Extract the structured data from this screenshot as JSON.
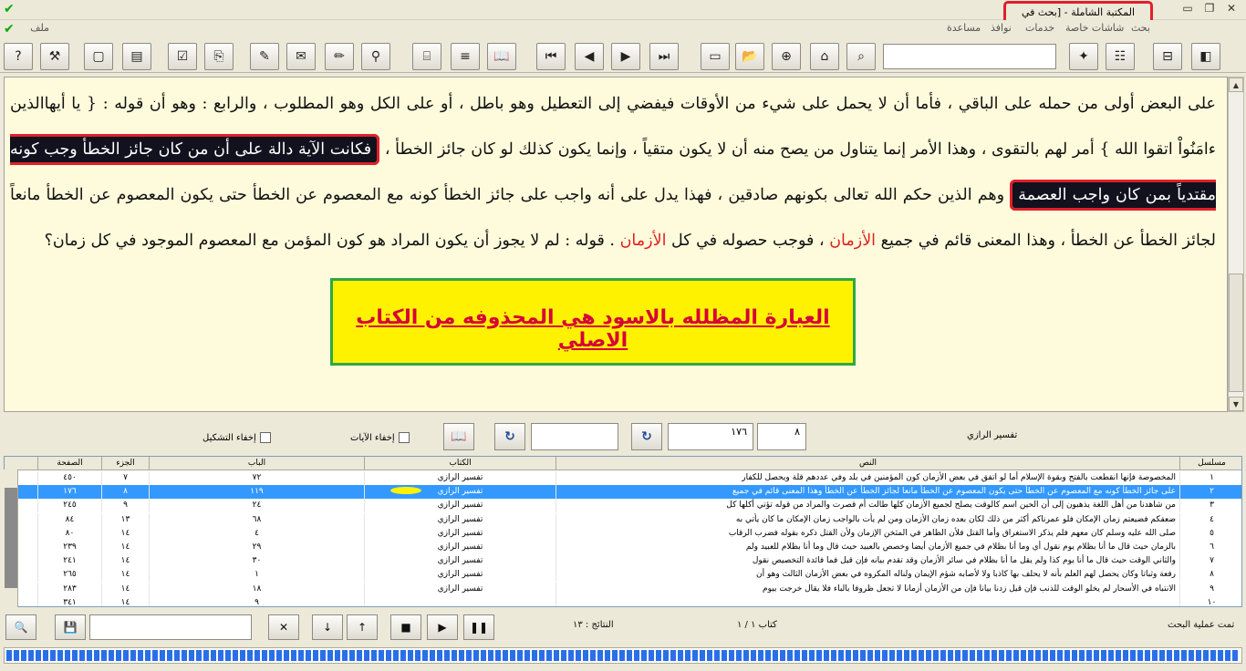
{
  "window": {
    "title": "المكتبة الشاملة - [بحث في النصوص]",
    "controls": [
      "▭",
      "❐",
      "✕"
    ]
  },
  "menu": [
    "ملف",
    "بحث",
    "شاشات خاصة",
    "خدمات",
    "نوافذ",
    "مساعدة"
  ],
  "toolbar": {
    "icons": [
      "help-icon",
      "tools-icon",
      "new-doc-icon",
      "table-icon",
      "checklist-icon",
      "copy-icon",
      "edit-doc-icon",
      "report-icon",
      "pencil-icon",
      "tree-icon",
      "properties-icon",
      "list-icon",
      "book-open-icon",
      "first-icon",
      "prev-icon",
      "next-icon",
      "last-icon",
      "window-icon",
      "folder-icon",
      "binoculars-icon",
      "browse-icon",
      "search-icon",
      "bookmark-icon",
      "toc-icon",
      "book-icon",
      "book-closed-icon"
    ],
    "glyphs": [
      "?",
      "⚒",
      "▢",
      "▤",
      "☑",
      "⎘",
      "✎",
      "✉",
      "✏",
      "⚲",
      "⌸",
      "≡",
      "📖",
      "⏮",
      "◀",
      "▶",
      "⏭",
      "▭",
      "📂",
      "⊕",
      "⌂",
      "⌕",
      "✦",
      "☷",
      "⊟",
      "◧"
    ],
    "search_value": ""
  },
  "text_pane": {
    "p1": "على البعض أولى من حمله على الباقي ، فأما أن لا يحمل على شيء من الأوقات فيفضي إلى التعطيل وهو باطل ، أو على الكل وهو المطلوب ، والرابع : وهو أن قوله : { يا أيهاالذين ءامَنُواْ اتقوا الله } أمر لهم بالتقوى ، وهذا الأمر إنما يتناول من يصح منه أن لا يكون متقياً ، وإنما يكون كذلك لو كان جائز الخطأ ،",
    "highlight1": "فكانت الآية دالة على أن من كان جائز الخطأ وجب كونه مقتدياً بمن كان واجب العصمة",
    "p2": "وهم الذين حكم الله تعالى بكونهم صادقين ، فهذا يدل على أنه واجب على جائز الخطأ كونه مع المعصوم عن الخطأ حتى يكون المعصوم عن الخطأ مانعاً لجائز الخطأ عن الخطأ ، وهذا المعنى قائم في جميع",
    "red1": "الأزمان",
    "p3": "، فوجب حصوله في كل",
    "red2": "الأزمان",
    "p4": ". قوله : لم لا يجوز أن يكون المراد هو كون المؤمن مع المعصوم الموجود في كل زمان؟",
    "notice": "العبارة المظلله بالاسود هي المحذوفه من الكتاب الاصلي"
  },
  "controls": {
    "book_name": "تفسير الرازي",
    "part_value": "٨",
    "page_value": "١٧٦",
    "goto_value": "",
    "hide_verses": "إخفاء الآيات",
    "hide_diacritics": "إخفاء التشكيل",
    "refresh_glyph": "↻"
  },
  "table": {
    "headers": {
      "serial": "مسلسل",
      "text": "النص",
      "book": "الكتاب",
      "chapter": "الباب",
      "part": "الجزء",
      "page": "الصفحة"
    },
    "rows": [
      {
        "serial": "١",
        "text": "المخصوصة فإنها انقطعت بالفتح وبقوة الإسلام أما لو اتفق في بعض الأزمان كون المؤمنين في بلد وفي عددهم قلة ويحصل للكفار",
        "book": "تفسير الرازي",
        "chapter": "٧٢",
        "part": "٧",
        "page": "٤٥٠"
      },
      {
        "serial": "٢",
        "text": "على جائز الخطأ كونه مع المعصوم عن الخطأ حتى يكون المعصوم عن الخطأ مانعا لجائز الخطأ عن الخطأ وهذا المعنى قائم في جميع",
        "book": "تفسير الرازي",
        "chapter": "١١٩",
        "part": "٨",
        "page": "١٧٦"
      },
      {
        "serial": "٣",
        "text": "من شاهدنا من أهل اللغة يذهبون إلى أن الحين اسم كالوقت يصلح لجميع الأزمان كلها طالت أم قصرت والمراد من قوله تؤتي أكلها كل",
        "book": "تفسير الرازي",
        "chapter": "٢٤",
        "part": "٩",
        "page": "٢٤٥"
      },
      {
        "serial": "٤",
        "text": "ضعفكم فضيعتم زمان الإمكان فلو عمرناكم أكثر من ذلك لكان بعده زمان الأزمان ومن لم يأت بالواجب زمان الإمكان ما كان يأتي به",
        "book": "تفسير الرازي",
        "chapter": "٦٨",
        "part": "١٣",
        "page": "٨٤"
      },
      {
        "serial": "٥",
        "text": "صلى الله عليه وسلم كان معهم فلم يذكر الاستغراق وأما القتل فلأن الظاهر في المثخن الإزمان ولأن القتل ذكره بقوله فضرب الرقاب",
        "book": "تفسير الرازي",
        "chapter": "٤",
        "part": "١٤",
        "page": "٨٠"
      },
      {
        "serial": "٦",
        "text": "بالزمان حيث قال ما أنا بظلام يوم نقول أي وما أنا بظلام في جميع الأزمان أيضا وخصص بالعبيد حيث قال وما أنا بظلام للعبيد ولم",
        "book": "تفسير الرازي",
        "chapter": "٢٩",
        "part": "١٤",
        "page": "٢٣٩"
      },
      {
        "serial": "٧",
        "text": "والثاني الوقت حيث قال ما أنا يوم كذا ولم يقل ما أنا بظلام في سائر الأزمان وقد تقدم بيانه فإن قيل فما فائدة التخصيص نقول",
        "book": "تفسير الرازي",
        "chapter": "٣٠",
        "part": "١٤",
        "page": "٢٤١"
      },
      {
        "serial": "٨",
        "text": "رفعة وثباتا وكان يحصل لهم العلم بأنه لا يحلف بها كاذبا ولا لأصابه شؤم الإيمان ولناله المكروه في بعض الأزمان الثالث وهو أن",
        "book": "تفسير الرازي",
        "chapter": "١",
        "part": "١٤",
        "page": "٢٦٥"
      },
      {
        "serial": "٩",
        "text": "الانتباه في الأسحار لم يخلو الوقت للذنب فإن قيل زدنا بيانا فإن من الأزمان أزمانا لا تجعل ظروفا بالباء فلا يقال خرجت بيوم",
        "book": "تفسير الرازي",
        "chapter": "١٨",
        "part": "١٤",
        "page": "٢٨٣"
      },
      {
        "serial": "١٠",
        "text": "",
        "book": "",
        "chapter": "٩",
        "part": "١٤",
        "page": "٣٤١"
      }
    ]
  },
  "bottom": {
    "find_value": "",
    "results": "النتائج : ١٣",
    "book_counter": "كتاب ١ / ١",
    "done": "تمت عملية البحث",
    "glyphs": {
      "search": "🔍",
      "save": "💾",
      "clear": "✕",
      "down": "↓",
      "up": "↑",
      "stop": "■",
      "play": "▶",
      "pause": "❚❚"
    },
    "progress": 1.0
  }
}
